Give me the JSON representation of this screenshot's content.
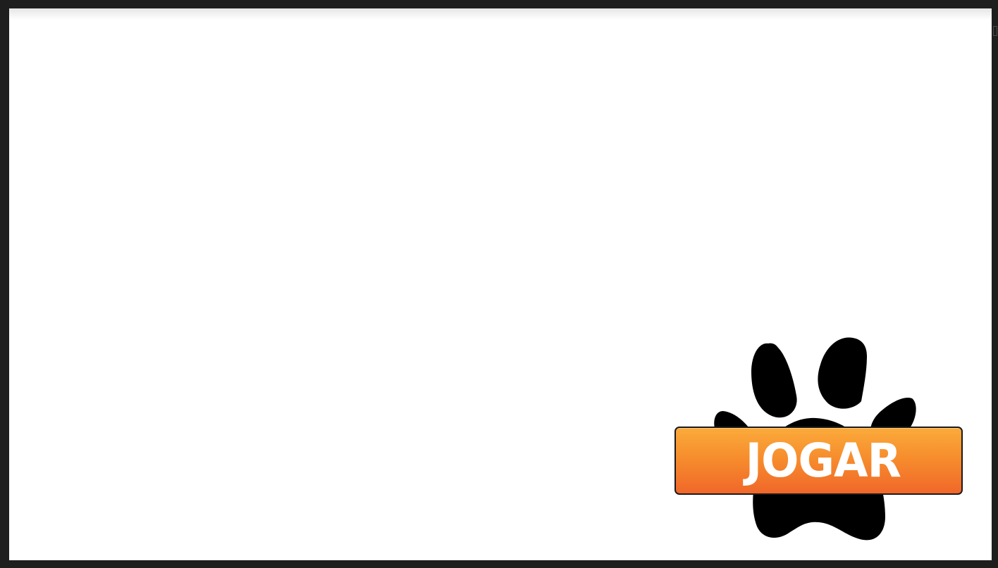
{
  "play_button": {
    "label": "JOGAR",
    "colors": {
      "top": "#fbab3b",
      "bottom": "#f0672a",
      "border": "#1b1b1b",
      "text": "#ffffff"
    }
  },
  "paw_icon": {
    "name": "paw-print-icon",
    "color": "#000000"
  },
  "canvas": {
    "background": "#ffffff",
    "frame_color": "#1e1e1e"
  }
}
